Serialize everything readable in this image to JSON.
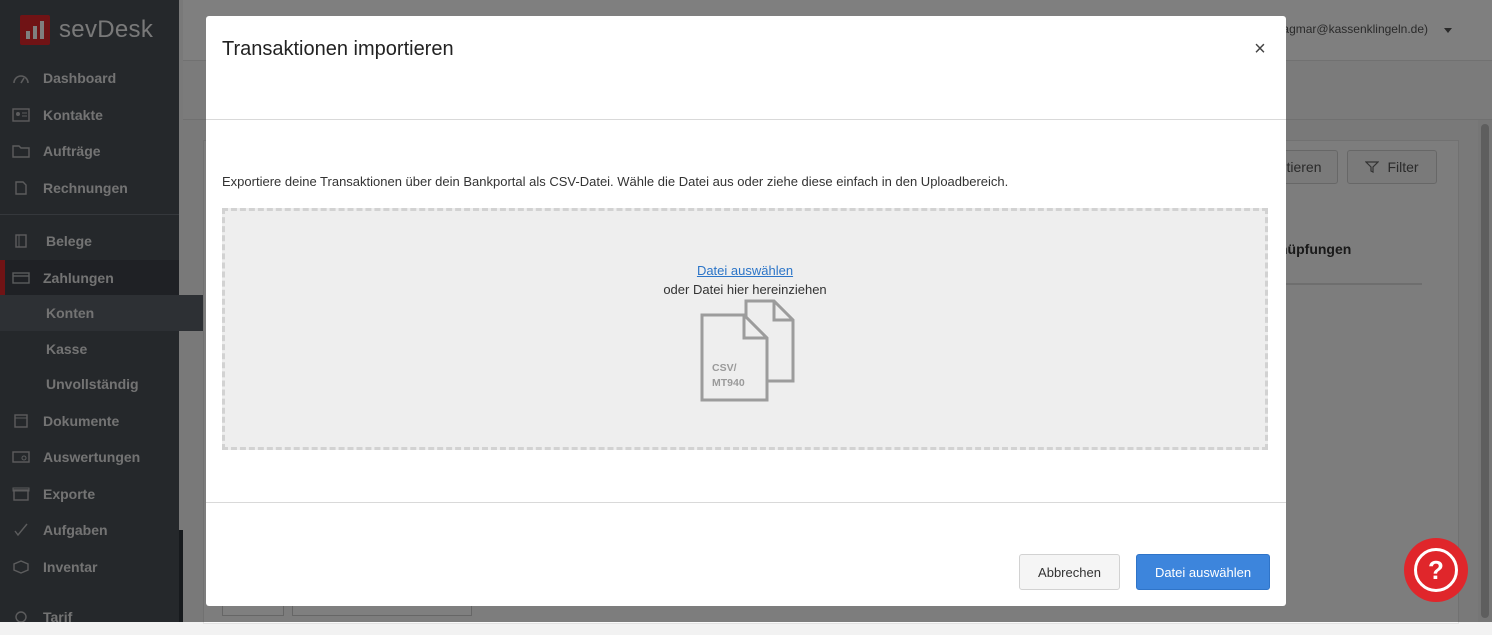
{
  "app": {
    "brand": "sevDesk",
    "user": "(dagmar@kassenklingeln.de)"
  },
  "sidebar": {
    "items": [
      {
        "label": "Dashboard",
        "icon": "dashboard-icon"
      },
      {
        "label": "Kontakte",
        "icon": "contacts-icon"
      },
      {
        "label": "Aufträge",
        "icon": "folder-icon"
      },
      {
        "label": "Rechnungen",
        "icon": "invoice-icon"
      },
      {
        "label": "Belege",
        "icon": "receipt-icon"
      },
      {
        "label": "Zahlungen",
        "icon": "payment-card-icon"
      },
      {
        "label": "Konten"
      },
      {
        "label": "Kasse"
      },
      {
        "label": "Unvollständig"
      },
      {
        "label": "Dokumente",
        "icon": "documents-icon"
      },
      {
        "label": "Auswertungen",
        "icon": "reports-icon"
      },
      {
        "label": "Exporte",
        "icon": "export-icon"
      },
      {
        "label": "Aufgaben",
        "icon": "check-icon"
      },
      {
        "label": "Inventar",
        "icon": "inventory-icon"
      },
      {
        "label": "Tarif",
        "icon": "tariff-icon"
      }
    ]
  },
  "background": {
    "buttons": {
      "import_partial": "tieren",
      "filter": "Filter"
    },
    "column_header_partial": "nüpfungen"
  },
  "modal": {
    "title": "Transaktionen importieren",
    "close_symbol": "×",
    "intro": "Exportiere deine Transaktionen über dein Bankportal als CSV-Datei. Wähle die Datei aus oder ziehe diese einfach in den Uploadbereich.",
    "dropzone": {
      "link": "Datei auswählen",
      "hint": "oder Datei hier hereinziehen",
      "file_label_line1": "CSV/",
      "file_label_line2": "MT940"
    },
    "buttons": {
      "cancel": "Abbrechen",
      "primary": "Datei auswählen"
    }
  },
  "colors": {
    "brand_red": "#e0262b",
    "primary_blue": "#3d85dc",
    "link_blue": "#2c75c8",
    "sidebar_bg": "#4a5057"
  }
}
